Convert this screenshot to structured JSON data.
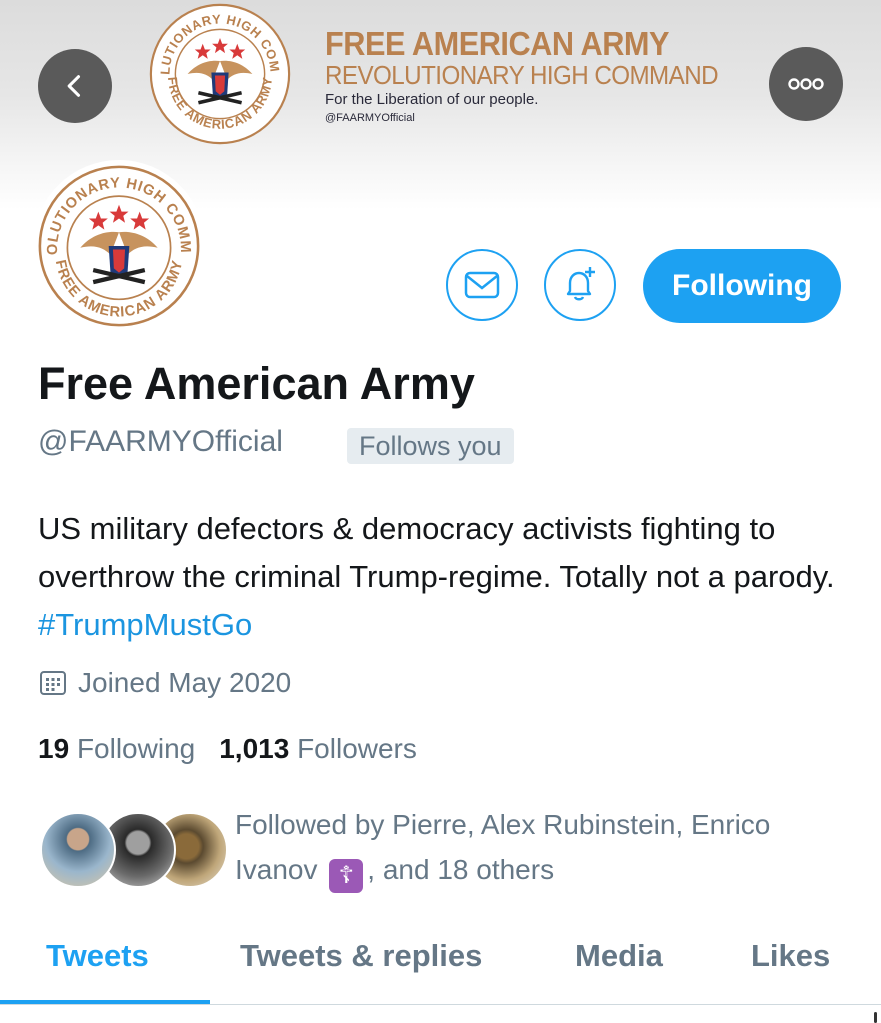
{
  "banner": {
    "title": "FREE AMERICAN ARMY",
    "subtitle": "REVOLUTIONARY HIGH COMMAND",
    "tagline": "For the Liberation of our people.",
    "handle": "@FAARMYOfficial",
    "seal_top_text": "REVOLUTIONARY HIGH COMMAND",
    "seal_bottom_text": "FREE AMERICAN ARMY"
  },
  "nav": {
    "back_icon": "chevron-left-icon",
    "more_icon": "more-horizontal-icon"
  },
  "actions": {
    "message_icon": "envelope-icon",
    "notify_icon": "bell-plus-icon",
    "following_label": "Following"
  },
  "profile": {
    "display_name": "Free American Army",
    "handle": "@FAARMYOfficial",
    "follows_you": "Follows you",
    "bio_text": "US military defectors & democracy activists fighting to overthrow the criminal Trump-regime. Totally not a parody.",
    "bio_hashtag": "#TrumpMustGo",
    "joined": "Joined May 2020",
    "following_count": "19",
    "following_label": "Following",
    "followers_count": "1,013",
    "followers_label": "Followers"
  },
  "followed_by": {
    "text_prefix": "Followed by Pierre, Alex Rubinstein, Enrico Ivanov",
    "emoji": "☦",
    "text_suffix": ", and 18 others"
  },
  "tabs": [
    {
      "label": "Tweets",
      "active": true
    },
    {
      "label": "Tweets & replies",
      "active": false
    },
    {
      "label": "Media",
      "active": false
    },
    {
      "label": "Likes",
      "active": false
    }
  ],
  "colors": {
    "accent": "#1da1f2",
    "secondary_text": "#657786",
    "banner_text": "#b9814f",
    "seal_red": "#d83a3a",
    "seal_navy": "#1f3a7a"
  }
}
